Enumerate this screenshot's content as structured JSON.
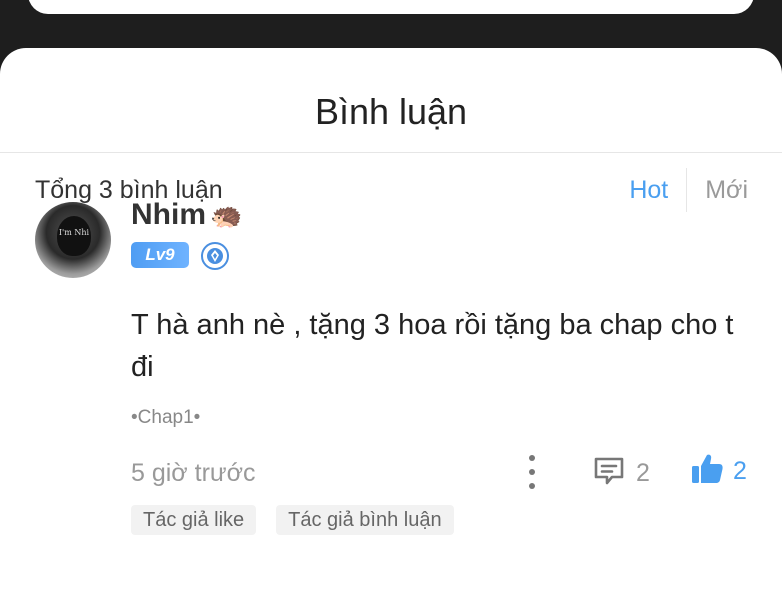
{
  "header": {
    "title": "Bình luận"
  },
  "comments_meta": {
    "total": "Tổng 3 bình luận",
    "sort": {
      "hot": "Hot",
      "new": "Mới"
    }
  },
  "comment": {
    "username": "Nhim",
    "username_emoji": "🦔",
    "level": "Lv9",
    "avatar_text": "I'm Nhi",
    "text": "T hà anh nè , tặng 3 hoa rồi tặng ba chap cho t đi",
    "chapter": "•Chap1•",
    "time": "5 giờ trước",
    "reply_count": "2",
    "like_count": "2",
    "tags": [
      "Tác giả like",
      "Tác giả bình luận"
    ]
  },
  "colors": {
    "accent": "#4a9ff0",
    "background_dark": "#1e1e1e",
    "sheet": "#ffffff"
  },
  "icons": {
    "more": "more-vertical-icon",
    "reply": "comment-bubble-icon",
    "like": "thumbs-up-icon",
    "rank": "diamond-rank-icon"
  }
}
